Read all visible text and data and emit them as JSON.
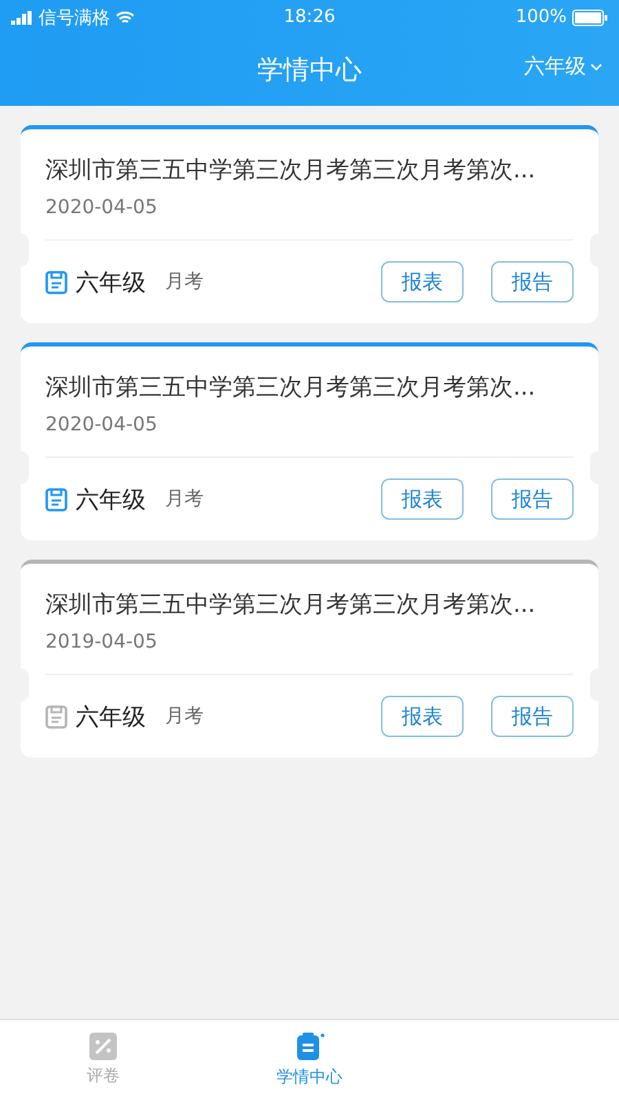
{
  "status_bar": {
    "carrier": "信号满格",
    "time": "18:26",
    "battery": "100%"
  },
  "header": {
    "title": "学情中心",
    "grade_filter": "六年级"
  },
  "exams": [
    {
      "title": "深圳市第三五中学第三次月考第三次月考第次...",
      "date": "2020-04-05",
      "grade": "六年级",
      "type": "月考",
      "active": true,
      "buttons": [
        "报表",
        "报告"
      ]
    },
    {
      "title": "深圳市第三五中学第三次月考第三次月考第次...",
      "date": "2020-04-05",
      "grade": "六年级",
      "type": "月考",
      "active": true,
      "buttons": [
        "报表",
        "报告"
      ]
    },
    {
      "title": "深圳市第三五中学第三次月考第三次月考第次...",
      "date": "2019-04-05",
      "grade": "六年级",
      "type": "月考",
      "active": false,
      "buttons": [
        "报表",
        "报告"
      ]
    }
  ],
  "tab_bar": [
    {
      "label": "评卷",
      "selected": false
    },
    {
      "label": "学情中心",
      "selected": true
    }
  ]
}
